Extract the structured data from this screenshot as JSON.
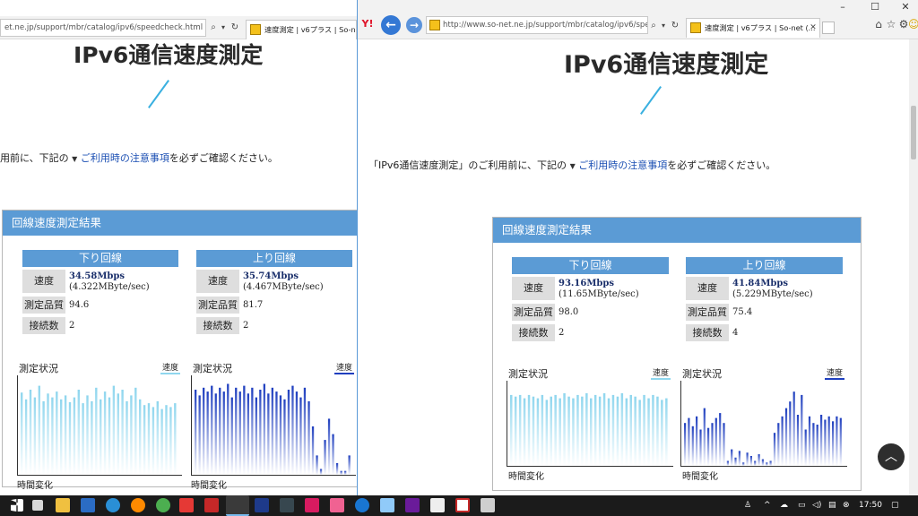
{
  "left_window": {
    "address": "et.ne.jp/support/mbr/catalog/ipv6/speedcheck.html",
    "tab_title": "速度測定 | v6プラス | So-net ...",
    "page_title": "IPv6通信速度測定",
    "notice_prefix": "用前に、下記の",
    "notice_link": "ご利用時の注意事項",
    "notice_suffix": "を必ずご確認ください。",
    "result_title": "回線速度測定結果",
    "down": {
      "head": "下り回線",
      "speed_label": "速度",
      "speed_main": "34.58Mbps",
      "speed_sub": "(4.322MByte/sec)",
      "quality_label": "測定品質",
      "quality": "94.6",
      "conn_label": "接続数",
      "conn": "2"
    },
    "up": {
      "head": "上り回線",
      "speed_label": "速度",
      "speed_main": "35.74Mbps",
      "speed_sub": "(4.467MByte/sec)",
      "quality_label": "測定品質",
      "quality": "81.7",
      "conn_label": "接続数",
      "conn": "2"
    },
    "status_label": "測定状況",
    "speed_link": "速度",
    "time_label": "時間変化"
  },
  "right_window": {
    "address": "http://www.so-net.ne.jp/support/mbr/catalog/ipv6/speec",
    "tab_title": "速度測定 | v6プラス | So-net (...",
    "page_title": "IPv6通信速度測定",
    "notice_prefix": "「IPv6通信速度測定」のご利用前に、下記の",
    "notice_link": "ご利用時の注意事項",
    "notice_suffix": "を必ずご確認ください。",
    "result_title": "回線速度測定結果",
    "down": {
      "head": "下り回線",
      "speed_label": "速度",
      "speed_main": "93.16Mbps",
      "speed_sub": "(11.65MByte/sec)",
      "quality_label": "測定品質",
      "quality": "98.0",
      "conn_label": "接続数",
      "conn": "2"
    },
    "up": {
      "head": "上り回線",
      "speed_label": "速度",
      "speed_main": "41.84Mbps",
      "speed_sub": "(5.229MByte/sec)",
      "quality_label": "測定品質",
      "quality": "75.4",
      "conn_label": "接続数",
      "conn": "4"
    },
    "status_label": "測定状況",
    "speed_link": "速度",
    "time_label": "時間変化"
  },
  "taskbar": {
    "time": "17:50"
  },
  "colors": {
    "accent": "#5b9bd5",
    "down_bar": "#8fd6ee",
    "up_bar": "#1f3fbf",
    "link": "#1b4fb3"
  },
  "chart_data": [
    {
      "type": "bar",
      "name": "left-down",
      "values": [
        0.85,
        0.78,
        0.88,
        0.8,
        0.92,
        0.76,
        0.84,
        0.8,
        0.86,
        0.78,
        0.82,
        0.75,
        0.8,
        0.88,
        0.74,
        0.82,
        0.76,
        0.9,
        0.78,
        0.86,
        0.8,
        0.92,
        0.84,
        0.88,
        0.76,
        0.82,
        0.9,
        0.78,
        0.72,
        0.74,
        0.7,
        0.76,
        0.68,
        0.72,
        0.7,
        0.74
      ]
    },
    {
      "type": "bar",
      "name": "left-up",
      "values": [
        0.88,
        0.82,
        0.9,
        0.86,
        0.92,
        0.84,
        0.9,
        0.86,
        0.94,
        0.8,
        0.9,
        0.86,
        0.92,
        0.84,
        0.9,
        0.8,
        0.88,
        0.94,
        0.84,
        0.9,
        0.86,
        0.82,
        0.78,
        0.88,
        0.92,
        0.86,
        0.8,
        0.9,
        0.76,
        0.5,
        0.2,
        0.06,
        0.36,
        0.58,
        0.42,
        0.12,
        0.04,
        0.04,
        0.2
      ]
    },
    {
      "type": "bar",
      "name": "right-down",
      "values": [
        0.86,
        0.84,
        0.86,
        0.82,
        0.86,
        0.84,
        0.82,
        0.86,
        0.8,
        0.84,
        0.86,
        0.82,
        0.88,
        0.84,
        0.82,
        0.86,
        0.84,
        0.88,
        0.82,
        0.86,
        0.84,
        0.88,
        0.82,
        0.86,
        0.84,
        0.88,
        0.82,
        0.86,
        0.84,
        0.8,
        0.86,
        0.82,
        0.86,
        0.84,
        0.8,
        0.82
      ]
    },
    {
      "type": "bar",
      "name": "right-up",
      "values": [
        0.52,
        0.58,
        0.48,
        0.6,
        0.44,
        0.7,
        0.46,
        0.52,
        0.58,
        0.64,
        0.52,
        0.06,
        0.2,
        0.1,
        0.18,
        0.04,
        0.16,
        0.12,
        0.06,
        0.14,
        0.08,
        0.04,
        0.06,
        0.4,
        0.52,
        0.6,
        0.7,
        0.78,
        0.9,
        0.62,
        0.86,
        0.44,
        0.6,
        0.52,
        0.5,
        0.62,
        0.56,
        0.6,
        0.54,
        0.6,
        0.58
      ]
    }
  ]
}
